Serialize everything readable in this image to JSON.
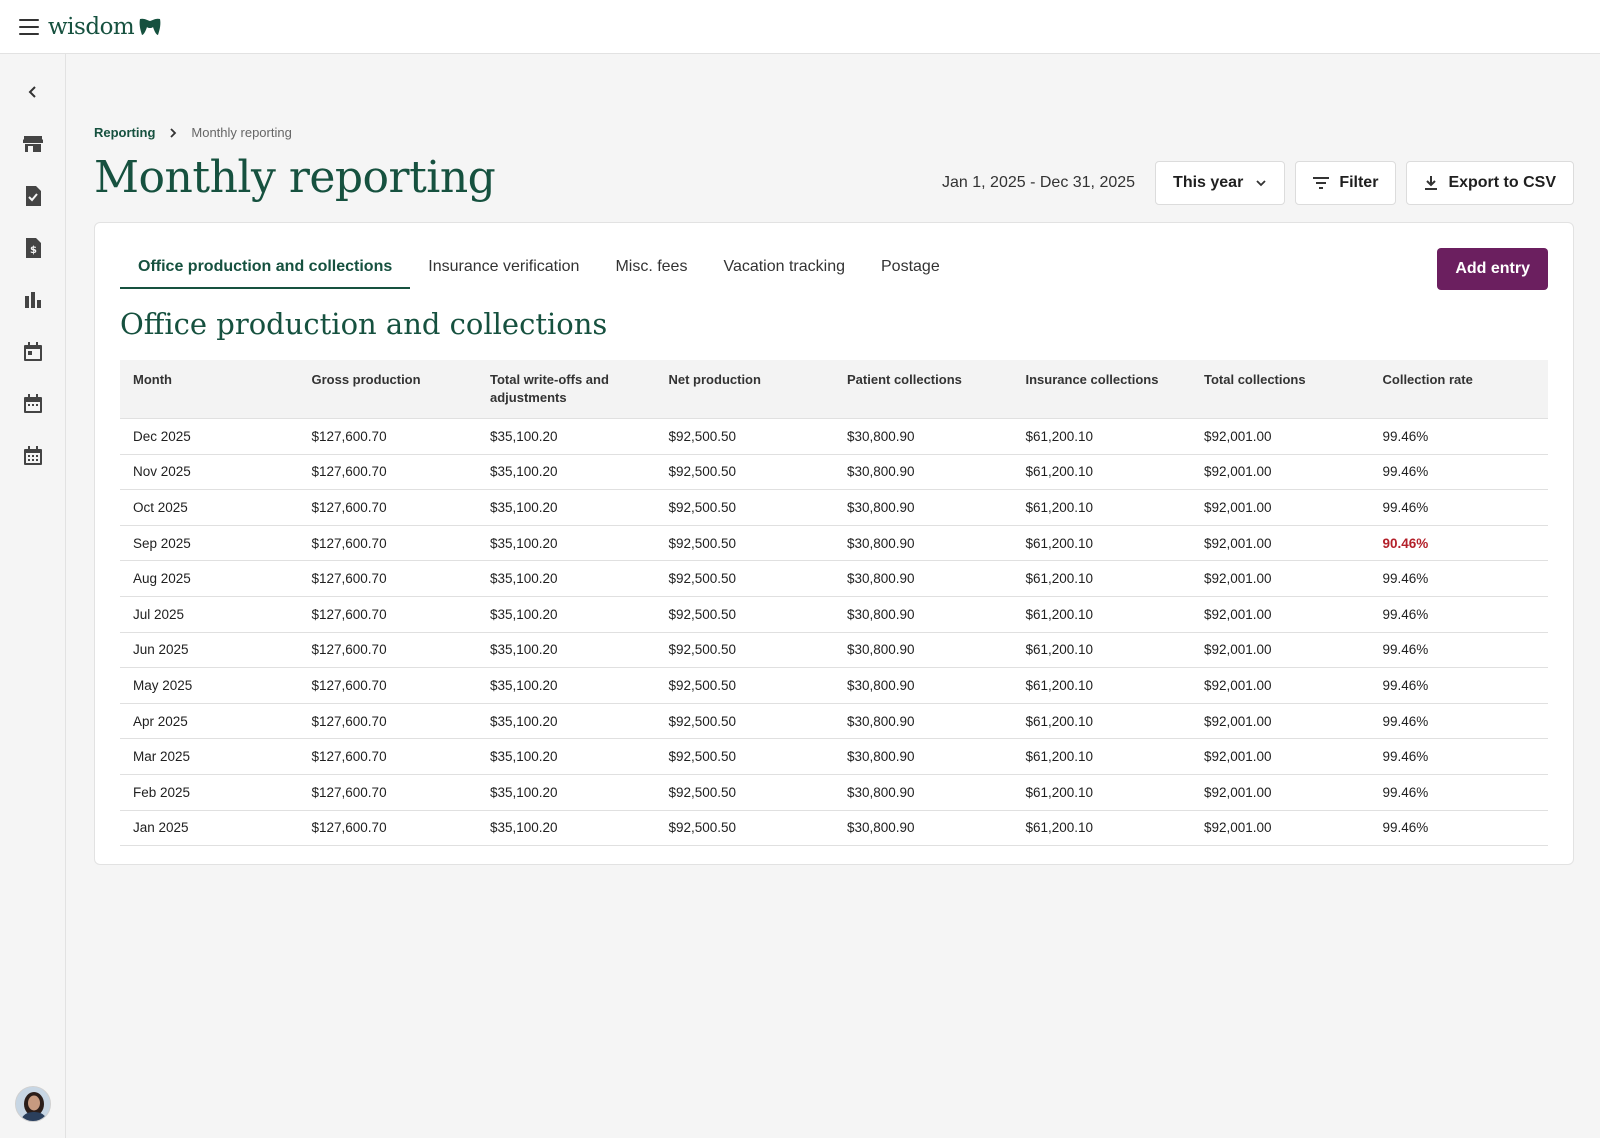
{
  "app": {
    "logo_text": "wisdom"
  },
  "colors": {
    "brand": "#16513f",
    "accent": "#6b1f5f",
    "alert": "#b3202a"
  },
  "rail": {
    "items": [
      {
        "icon": "chevron-left-icon"
      },
      {
        "icon": "store-icon"
      },
      {
        "icon": "document-check-icon"
      },
      {
        "icon": "document-dollar-icon"
      },
      {
        "icon": "bar-chart-icon"
      },
      {
        "icon": "calendar-event-icon"
      },
      {
        "icon": "calendar-icon"
      },
      {
        "icon": "calendar-grid-icon"
      }
    ]
  },
  "breadcrumb": {
    "parent": "Reporting",
    "current": "Monthly reporting"
  },
  "page": {
    "title": "Monthly reporting"
  },
  "controls": {
    "date_range": "Jan 1, 2025 - Dec 31, 2025",
    "period": "This year",
    "filter_label": "Filter",
    "export_label": "Export to CSV"
  },
  "tabs": [
    {
      "label": "Office production and collections",
      "active": true
    },
    {
      "label": "Insurance verification",
      "active": false
    },
    {
      "label": "Misc. fees",
      "active": false
    },
    {
      "label": "Vacation tracking",
      "active": false
    },
    {
      "label": "Postage",
      "active": false
    }
  ],
  "add_entry_label": "Add entry",
  "section_title": "Office production and collections",
  "table": {
    "columns": [
      "Month",
      "Gross production",
      "Total write-offs and adjustments",
      "Net production",
      "Patient collections",
      "Insurance collections",
      "Total collections",
      "Collection rate"
    ],
    "rows": [
      [
        "Dec 2025",
        "$127,600.70",
        "$35,100.20",
        "$92,500.50",
        "$30,800.90",
        "$61,200.10",
        "$92,001.00",
        "99.46%"
      ],
      [
        "Nov 2025",
        "$127,600.70",
        "$35,100.20",
        "$92,500.50",
        "$30,800.90",
        "$61,200.10",
        "$92,001.00",
        "99.46%"
      ],
      [
        "Oct 2025",
        "$127,600.70",
        "$35,100.20",
        "$92,500.50",
        "$30,800.90",
        "$61,200.10",
        "$92,001.00",
        "99.46%"
      ],
      [
        "Sep 2025",
        "$127,600.70",
        "$35,100.20",
        "$92,500.50",
        "$30,800.90",
        "$61,200.10",
        "$92,001.00",
        "90.46%"
      ],
      [
        "Aug 2025",
        "$127,600.70",
        "$35,100.20",
        "$92,500.50",
        "$30,800.90",
        "$61,200.10",
        "$92,001.00",
        "99.46%"
      ],
      [
        "Jul 2025",
        "$127,600.70",
        "$35,100.20",
        "$92,500.50",
        "$30,800.90",
        "$61,200.10",
        "$92,001.00",
        "99.46%"
      ],
      [
        "Jun 2025",
        "$127,600.70",
        "$35,100.20",
        "$92,500.50",
        "$30,800.90",
        "$61,200.10",
        "$92,001.00",
        "99.46%"
      ],
      [
        "May 2025",
        "$127,600.70",
        "$35,100.20",
        "$92,500.50",
        "$30,800.90",
        "$61,200.10",
        "$92,001.00",
        "99.46%"
      ],
      [
        "Apr 2025",
        "$127,600.70",
        "$35,100.20",
        "$92,500.50",
        "$30,800.90",
        "$61,200.10",
        "$92,001.00",
        "99.46%"
      ],
      [
        "Mar 2025",
        "$127,600.70",
        "$35,100.20",
        "$92,500.50",
        "$30,800.90",
        "$61,200.10",
        "$92,001.00",
        "99.46%"
      ],
      [
        "Feb 2025",
        "$127,600.70",
        "$35,100.20",
        "$92,500.50",
        "$30,800.90",
        "$61,200.10",
        "$92,001.00",
        "99.46%"
      ],
      [
        "Jan 2025",
        "$127,600.70",
        "$35,100.20",
        "$92,500.50",
        "$30,800.90",
        "$61,200.10",
        "$92,001.00",
        "99.46%"
      ]
    ],
    "alert_rows": [
      3
    ]
  }
}
